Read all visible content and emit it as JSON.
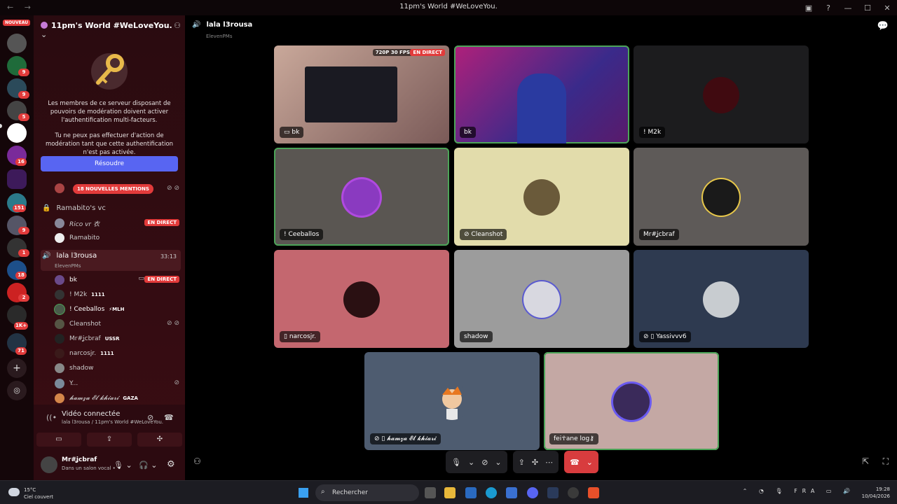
{
  "window": {
    "title": "11pm's World #WeLoveYou.",
    "nav": "← →",
    "controls": [
      "▣",
      "?",
      "—",
      "☐",
      "✕"
    ]
  },
  "servers": {
    "nouveau": "NOUVEAU",
    "badges": [
      "9",
      "9",
      "5",
      "16",
      "151",
      "9",
      "1",
      "18",
      "2",
      "1K+",
      "71"
    ]
  },
  "sidebar": {
    "server_name": "11pm's World #WeLoveYou.",
    "mfa_text1": "Les membres de ce serveur disposant de pouvoirs de modération doivent activer l'authentification multi-facteurs.",
    "mfa_text2": "Tu ne peux pas effectuer d'action de modération tant que cette authentification n'est pas activée.",
    "resolve_label": "Résoudre",
    "mentions": "18 NOUVELLES MENTIONS",
    "channel1": {
      "name": "Ramabito's vc",
      "members": [
        {
          "name": "Rico vr 衣",
          "live": "EN DIRECT"
        },
        {
          "name": "Ramabito"
        }
      ]
    },
    "channel2": {
      "name": "lala l3rousa",
      "sub": "ElevenPMs",
      "time": "33:13",
      "members": [
        {
          "name": "bk",
          "live": "EN DIRECT"
        },
        {
          "name": "! M2k",
          "tag": "1111"
        },
        {
          "name": "! Ceeballos",
          "tag": "⚡MLH"
        },
        {
          "name": "Cleanshot"
        },
        {
          "name": "Mr#ʝcbraf",
          "tag": "USSR"
        },
        {
          "name": "narcosjr.",
          "tag": "1111"
        },
        {
          "name": "shadow"
        },
        {
          "name": "Y..."
        },
        {
          "name": "𝓱𝓪𝓶𝔃𝓪 𝓔𝓵 𝓴𝓱𝓲𝓪𝓻𝓲",
          "tag": "GAZA"
        }
      ]
    }
  },
  "voice": {
    "status": "Vidéo connectée",
    "location": "lala l3rousa / 11pm's World #WeLoveYou.",
    "user": "Mr#ʝcbraf",
    "user_status": "Dans un salon vocal •"
  },
  "channel": {
    "name": "lala l3rousa",
    "sub": "ElevenPMs"
  },
  "tiles": [
    {
      "label": "bk",
      "fps": "720P 30 FPS",
      "live": "EN DIRECT"
    },
    {
      "label": "bk"
    },
    {
      "label": "! M2k"
    },
    {
      "label": "! Ceeballos"
    },
    {
      "label": "Cleanshot"
    },
    {
      "label": "Mr#ʝcbraf"
    },
    {
      "label": "narcosjr."
    },
    {
      "label": "shadow"
    },
    {
      "label": "Yassivvv6"
    },
    {
      "label": "𝓱𝓪𝓶𝔃𝓪 𝓔𝓵 𝓴𝓱𝓲𝓪𝓻𝓲"
    },
    {
      "label": "fei☥ane log⚷"
    }
  ],
  "taskbar": {
    "temp": "15°C",
    "weather": "Ciel couvert",
    "search": "Rechercher",
    "lang": "FRA",
    "time": "19:28",
    "date": "10/04/2026"
  },
  "colors": {
    "accent": "#5865f2",
    "live": "#e23b3b",
    "speaking": "#4ca458",
    "sidebar": "#3a0d13"
  }
}
